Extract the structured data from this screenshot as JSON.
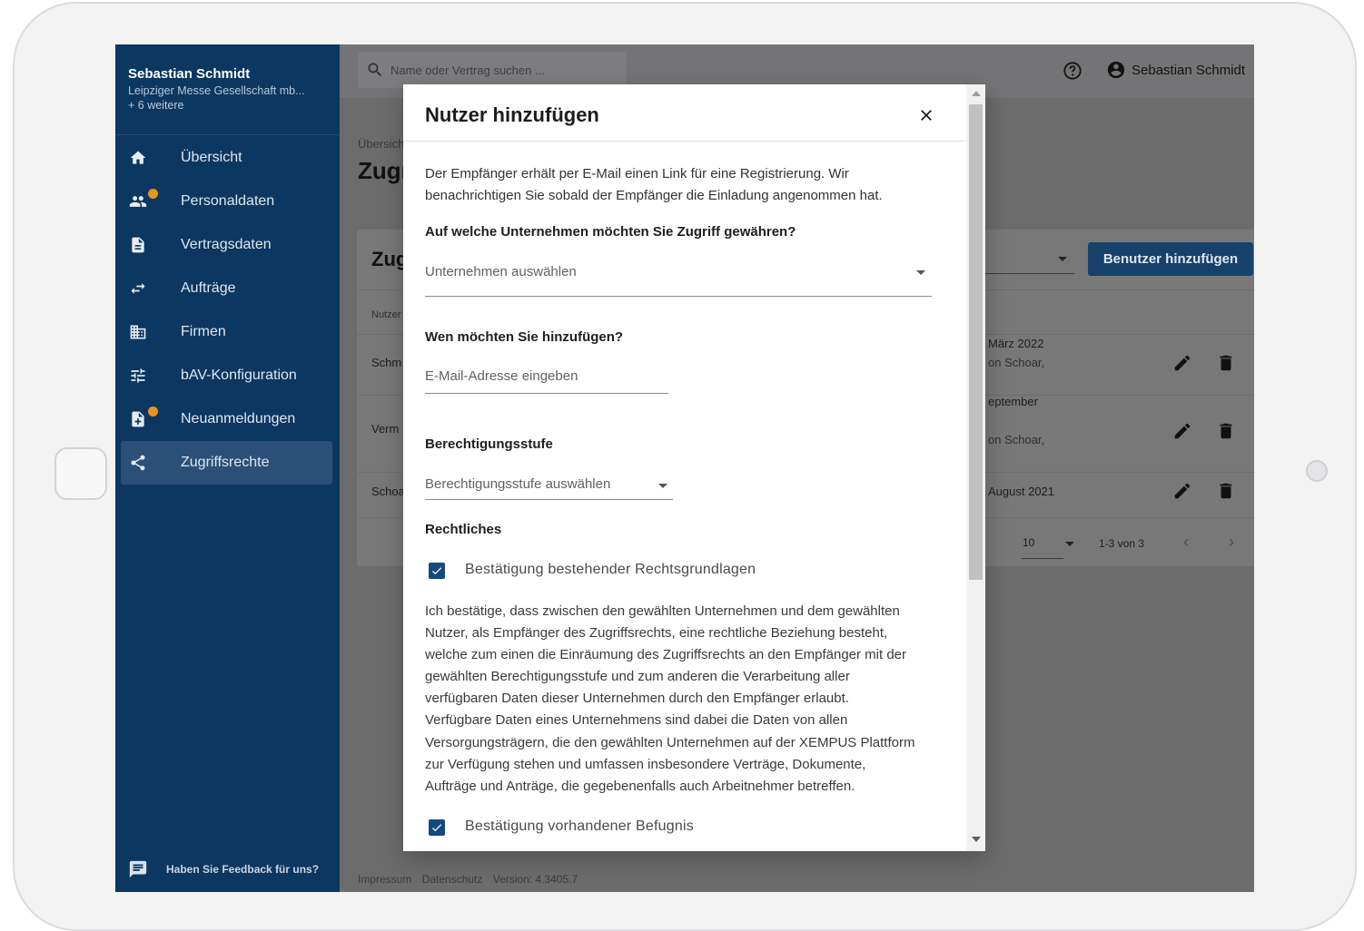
{
  "sidebar": {
    "user_name": "Sebastian Schmidt",
    "company": "Leipziger Messe Gesellschaft mb...",
    "more": "+ 6 weitere",
    "items": [
      {
        "label": "Übersicht",
        "icon": "home-icon",
        "dot": false,
        "active": false
      },
      {
        "label": "Personaldaten",
        "icon": "people-icon",
        "dot": true,
        "active": false
      },
      {
        "label": "Vertragsdaten",
        "icon": "document-icon",
        "dot": false,
        "active": false
      },
      {
        "label": "Aufträge",
        "icon": "swap-arrows-icon",
        "dot": false,
        "active": false
      },
      {
        "label": "Firmen",
        "icon": "building-icon",
        "dot": false,
        "active": false
      },
      {
        "label": "bAV-Konfiguration",
        "icon": "tune-icon",
        "dot": false,
        "active": false
      },
      {
        "label": "Neuanmeldungen",
        "icon": "note-add-icon",
        "dot": true,
        "active": false
      },
      {
        "label": "Zugriffsrechte",
        "icon": "share-icon",
        "dot": false,
        "active": true
      }
    ],
    "feedback": "Haben Sie Feedback für uns?",
    "dot_color": "#e7951f"
  },
  "topbar": {
    "search_placeholder": "Name oder Vertrag suchen ...",
    "user_name": "Sebastian Schmidt"
  },
  "page": {
    "breadcrumb": "Übersich",
    "title": "Zugr",
    "card_title": "Zug",
    "add_button": "Benutzer hinzufügen",
    "col_head": "Nutzer",
    "rows": [
      {
        "name": "Schm",
        "date": "März 2022",
        "sub": "on Schoar,"
      },
      {
        "name": "Verm",
        "date": "eptember",
        "sub": "on Schoar,"
      },
      {
        "name": "Schoa",
        "date": "August 2021",
        "sub": ""
      }
    ],
    "page_size_label": "",
    "page_size": "10",
    "page_range": "1-3 von 3",
    "accent_color": "#16416b"
  },
  "footer": {
    "impressum": "Impressum",
    "datenschutz": "Datenschutz",
    "version": "Version: 4.3405.7"
  },
  "modal": {
    "title": "Nutzer hinzufügen",
    "intro_1": "Der Empfänger erhält per E-Mail einen Link für eine Registrierung. Wir",
    "intro_2": "benachrichtigen Sie sobald der Empfänger die Einladung angenommen hat.",
    "company_question": "Auf welche Unternehmen möchten Sie Zugriff gewähren?",
    "company_placeholder": "Unternehmen auswählen",
    "who_question": "Wen möchten Sie hinzufügen?",
    "email_placeholder": "E-Mail-Adresse eingeben",
    "permission_heading": "Berechtigungsstufe",
    "permission_placeholder": "Berechtigungsstufe auswählen",
    "legal_heading": "Rechtliches",
    "check_1_label": "Bestätigung bestehender Rechtsgrundlagen",
    "check_1_checked": true,
    "legal_lines": [
      "Ich bestätige, dass zwischen den gewählten Unternehmen und dem gewählten",
      "Nutzer, als Empfänger des Zugriffsrechts, eine rechtliche Beziehung besteht,",
      "welche zum einen die Einräumung des Zugriffsrechts an den Empfänger mit der",
      "gewählten Berechtigungsstufe und zum anderen die Verarbeitung aller",
      "verfügbaren Daten dieser Unternehmen durch den Empfänger erlaubt.",
      "Verfügbare Daten eines Unternehmens sind dabei die Daten von allen",
      "Versorgungsträgern, die den gewählten Unternehmen auf der XEMPUS Plattform",
      "zur Verfügung stehen und umfassen insbesondere Verträge, Dokumente,",
      "Aufträge und Anträge, die gegebenenfalls auch Arbeitnehmer betreffen."
    ],
    "check_2_label": "Bestätigung vorhandener Befugnis",
    "check_2_checked": true,
    "checkbox_color": "#154a7d"
  }
}
